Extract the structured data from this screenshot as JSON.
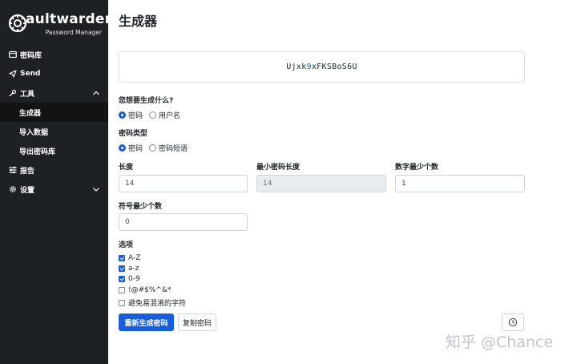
{
  "sidebar": {
    "logo_word": "aultwarden",
    "logo_sub": "Password Manager",
    "items": [
      {
        "label": "密码库",
        "icon": "vault-icon"
      },
      {
        "label": "Send",
        "icon": "send-icon"
      },
      {
        "label": "工具",
        "icon": "wrench-icon",
        "expanded": true,
        "children": [
          {
            "label": "生成器",
            "active": true
          },
          {
            "label": "导入数据"
          },
          {
            "label": "导出密码库"
          }
        ]
      },
      {
        "label": "报告",
        "icon": "sliders-icon"
      },
      {
        "label": "设置",
        "icon": "gear-icon"
      }
    ]
  },
  "main": {
    "title": "生成器",
    "generated_password_prefix": "Ujxk",
    "generated_password_digit": "9",
    "generated_password_suffix": "xFKSBoS6U",
    "what_to_generate": {
      "label": "您想要生成什么?",
      "options": [
        "密码",
        "用户名"
      ],
      "selected": "密码"
    },
    "password_type": {
      "label": "密码类型",
      "options": [
        "密码",
        "密码短语"
      ],
      "selected": "密码"
    },
    "length": {
      "label": "长度",
      "value": "14"
    },
    "min_length": {
      "label": "最小密码长度",
      "value": "14"
    },
    "min_numbers": {
      "label": "数字最少个数",
      "value": "1"
    },
    "min_special": {
      "label": "符号最少个数",
      "value": "0"
    },
    "options": {
      "label": "选项",
      "items": [
        {
          "label": "A-Z",
          "checked": true
        },
        {
          "label": "a-z",
          "checked": true
        },
        {
          "label": "0-9",
          "checked": true
        },
        {
          "label": "!@#$%^&*",
          "checked": false
        },
        {
          "label": "避免易混淆的字符",
          "checked": false
        }
      ]
    },
    "regenerate_label": "重新生成密码",
    "copy_label": "复制密码",
    "history_icon": "history-icon"
  },
  "watermark": "知乎 @Chance",
  "colors": {
    "sidebar_bg": "#1e2124",
    "accent": "#175ddc",
    "digit": "#1763a6"
  }
}
